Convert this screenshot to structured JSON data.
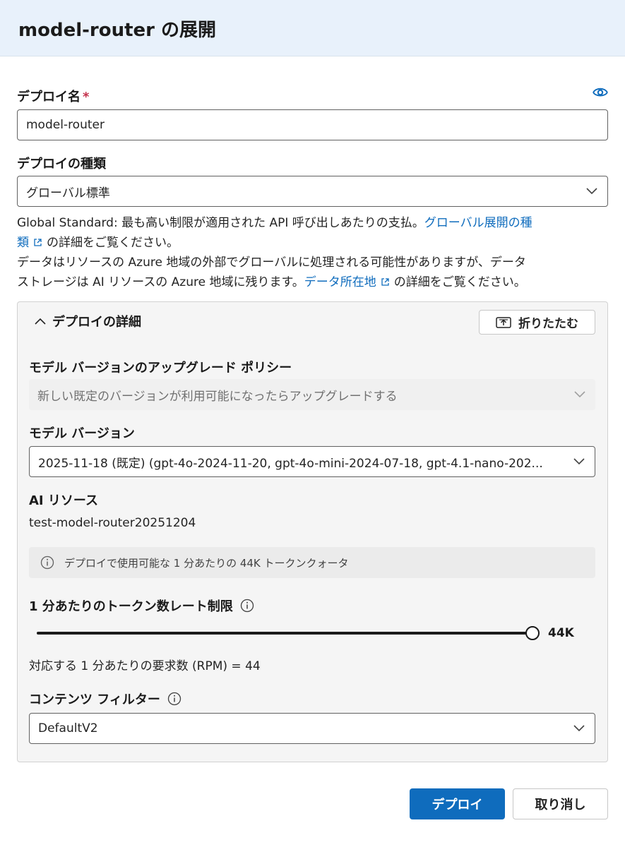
{
  "header": {
    "title": "model-router の展開"
  },
  "deploy_name": {
    "label": "デプロイ名",
    "required_mark": "*",
    "value": "model-router"
  },
  "deploy_type": {
    "label": "デプロイの種類",
    "value": "グローバル標準",
    "desc_line1_prefix": "Global Standard: 最も高い制限が適用された API 呼び出しあたりの支払。",
    "desc_line1_link": "グローバル展開の種",
    "desc_line2_link": "類",
    "desc_line2_suffix": "の詳細をご覧ください。",
    "desc_line3": "データはリソースの Azure 地域の外部でグローバルに処理される可能性がありますが、データ",
    "desc_line4_prefix": "ストレージは AI リソースの Azure 地域に残ります。",
    "desc_line4_link": "データ所在地",
    "desc_line4_suffix": "の詳細をご覧ください。"
  },
  "details": {
    "title": "デプロイの詳細",
    "collapse_label": "折りたたむ",
    "upgrade_policy": {
      "label": "モデル バージョンのアップグレード ポリシー",
      "value": "新しい既定のバージョンが利用可能になったらアップグレードする"
    },
    "model_version": {
      "label": "モデル バージョン",
      "value": "2025-11-18 (既定) (gpt-4o-2024-11-20, gpt-4o-mini-2024-07-18, gpt-4.1-nano-202..."
    },
    "ai_resource": {
      "label": "AI リソース",
      "value": "test-model-router20251204"
    },
    "quota_info": "デプロイで使用可能な 1 分あたりの 44K トークンクォータ",
    "rate_limit": {
      "label": "1 分あたりのトークン数レート制限",
      "value_label": "44K",
      "fraction": 1.0
    },
    "rpm_text": "対応する 1 分あたりの要求数 (RPM) = 44",
    "content_filter": {
      "label": "コンテンツ フィルター",
      "value": "DefaultV2"
    }
  },
  "actions": {
    "deploy_label": "デプロイ",
    "cancel_label": "取り消し"
  },
  "colors": {
    "accent": "#0f6cbd",
    "required": "#c4314b",
    "panel_bg": "#f5f5f5"
  }
}
